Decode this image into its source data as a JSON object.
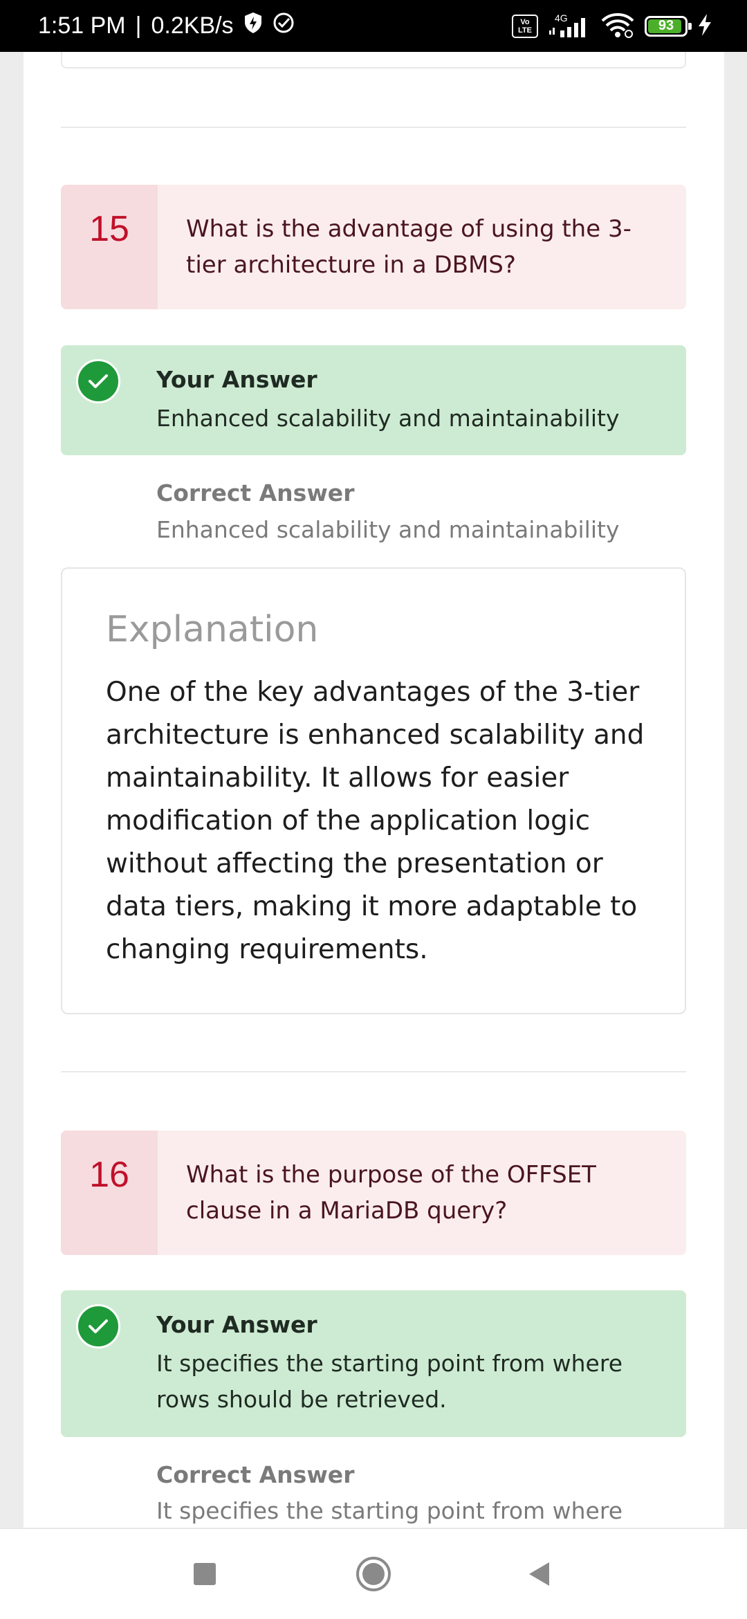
{
  "status_bar": {
    "time": "1:51 PM",
    "separator": "|",
    "speed": "0.2KB/s",
    "volte_top": "Vo",
    "volte_bottom": "LTE",
    "network": "4G",
    "battery": "93",
    "battery_level": 0.93
  },
  "questions": [
    {
      "number": "15",
      "text": "What is the advantage of using the 3-tier architecture in a DBMS?",
      "your_answer_label": "Your Answer",
      "your_answer": "Enhanced scalability and maintainability",
      "correct_answer_label": "Correct Answer",
      "correct_answer": "Enhanced scalability and maintainability",
      "explanation_title": "Explanation",
      "explanation": "One of the key advantages of the 3-tier architecture is enhanced scalability and maintainability. It allows for easier modification of the application logic without affecting the presentation or data tiers, making it more adaptable to changing requirements."
    },
    {
      "number": "16",
      "text": "What is the purpose of the OFFSET clause in a MariaDB query?",
      "your_answer_label": "Your Answer",
      "your_answer": "It specifies the starting point from where rows should be retrieved.",
      "correct_answer_label": "Correct Answer",
      "correct_answer": "It specifies the starting point from where rows"
    }
  ],
  "colors": {
    "question_number": "#c0102a",
    "answer_bg": "#cdebd2",
    "check": "#1f9a3a",
    "question_bg": "#fbeded"
  }
}
